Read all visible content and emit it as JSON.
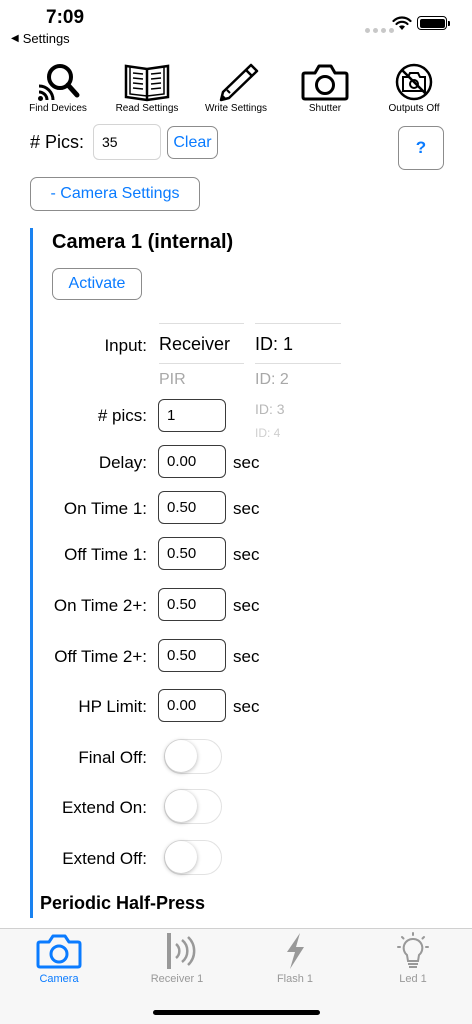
{
  "status": {
    "time": "7:09",
    "back_label": "Settings"
  },
  "toolbar": {
    "items": [
      {
        "label": "Find Devices",
        "icon": "search-device-icon"
      },
      {
        "label": "Read Settings",
        "icon": "book-icon"
      },
      {
        "label": "Write Settings",
        "icon": "pencil-icon"
      },
      {
        "label": "Shutter",
        "icon": "camera-icon"
      },
      {
        "label": "Outputs Off",
        "icon": "camera-off-icon"
      }
    ]
  },
  "pics": {
    "label": "# Pics:",
    "value": "35",
    "clear_label": "Clear",
    "help_label": "?"
  },
  "camera_settings_button": "- Camera Settings",
  "section": {
    "title": "Camera 1 (internal)",
    "activate_label": "Activate",
    "input_label": "Input:",
    "input_picker": {
      "selected": "Receiver",
      "items": [
        "PIR"
      ]
    },
    "id_picker": {
      "selected": "ID: 1",
      "items": [
        "ID: 2",
        "ID: 3",
        "ID: 4"
      ]
    },
    "fields": [
      {
        "label": "# pics:",
        "value": "1",
        "unit": ""
      },
      {
        "label": "Delay:",
        "value": "0.00",
        "unit": "sec"
      },
      {
        "label": "On Time 1:",
        "value": "0.50",
        "unit": "sec"
      },
      {
        "label": "Off Time 1:",
        "value": "0.50",
        "unit": "sec"
      },
      {
        "label": "On Time 2+:",
        "value": "0.50",
        "unit": "sec"
      },
      {
        "label": "Off Time 2+:",
        "value": "0.50",
        "unit": "sec"
      },
      {
        "label": "HP Limit:",
        "value": "0.00",
        "unit": "sec"
      }
    ],
    "toggles": [
      {
        "label": "Final Off:",
        "on": false
      },
      {
        "label": "Extend On:",
        "on": false
      },
      {
        "label": "Extend Off:",
        "on": false
      }
    ],
    "periodic_title": "Periodic Half-Press"
  },
  "tabs": [
    {
      "label": "Camera",
      "icon": "camera-icon",
      "active": true
    },
    {
      "label": "Receiver 1",
      "icon": "receiver-icon",
      "active": false
    },
    {
      "label": "Flash 1",
      "icon": "lightning-icon",
      "active": false
    },
    {
      "label": "Led 1",
      "icon": "lightbulb-icon",
      "active": false
    }
  ],
  "colors": {
    "accent": "#0a7bff",
    "section_bar": "#1a82f0",
    "inactive_tab": "#999999"
  }
}
